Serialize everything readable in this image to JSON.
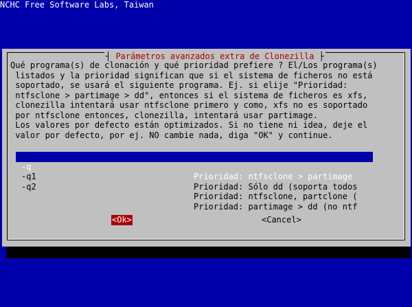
{
  "backtitle": "NCHC Free Software Labs, Taiwan",
  "dialog": {
    "title": "Parámetros avanzados extra de Clonezilla",
    "description": "Qué programa(s) de clonación y qué prioridad prefiere ? El/Los programa(s)\n listados y la prioridad significan que si el sistema de ficheros no está\n soportado, se usará el siguiente programa. Ej. si elije \"Prioridad:\n ntfsclone > partimage > dd\", entonces si el sistema de ficheros es xfs,\n clonezilla intentará usar ntfsclone primero y como, xfs no es soportado\n por ntfsclone entonces, clonezilla, intentará usar partimage.\n Los valores por defecto están optimizados. Si no tiene ni idea, deje el\n valor por defecto, por ej. NO cambie nada, diga \"OK\" y continue.",
    "options": [
      {
        "tag": "-q",
        "item": "Prioridad: ntfsclone > partimage",
        "selected": true
      },
      {
        "tag": "-q1",
        "item": "Prioridad: Sólo dd (soporta todos",
        "selected": false
      },
      {
        "tag": "-q2",
        "item": "Prioridad: ntfsclone, partclone (",
        "selected": false
      },
      {
        "tag": "",
        "item": "Prioridad: partimage > dd (no ntf",
        "selected": false
      }
    ],
    "ok_label": "<Ok>",
    "cancel_label": "<Cancel>"
  },
  "colors": {
    "background": "#0000aa",
    "dialog": "#c0c0c0",
    "title": "#aa0000",
    "selection": "#0000aa",
    "ok_button": "#aa0000"
  }
}
